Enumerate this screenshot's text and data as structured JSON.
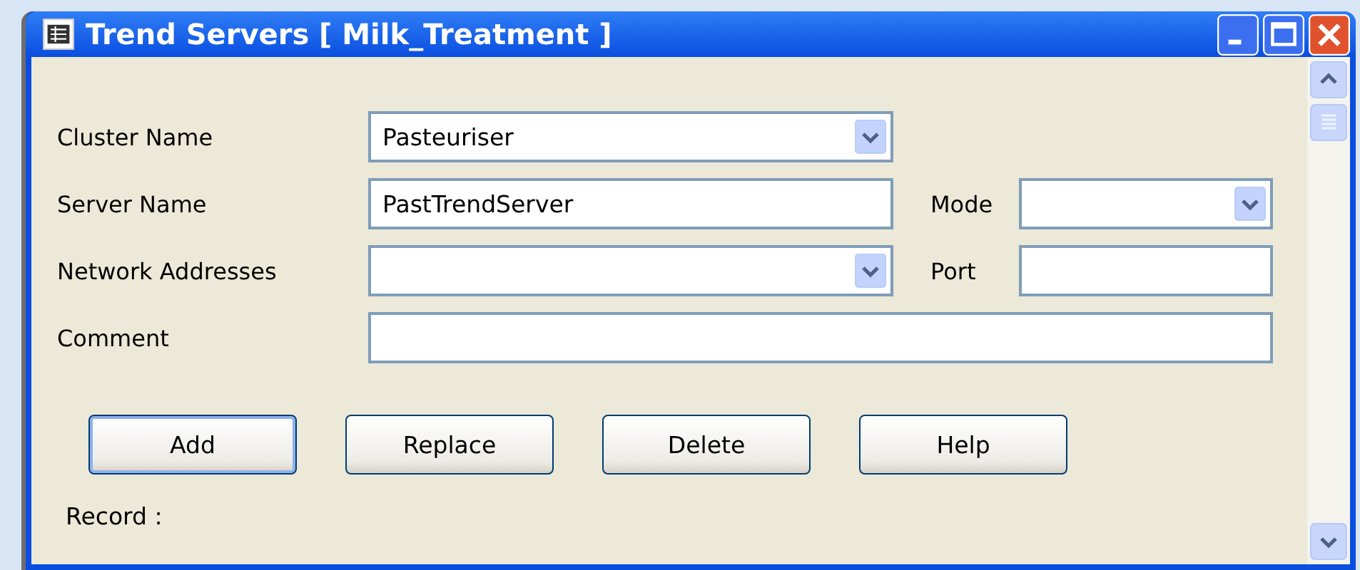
{
  "window": {
    "title": "Trend Servers [ Milk_Treatment ]"
  },
  "rows": [
    {
      "label": "Cluster Name",
      "field": {
        "kind": "combo",
        "value": "Pasteuriser"
      }
    },
    {
      "label": "Server Name",
      "field": {
        "kind": "text",
        "value": "PastTrendServer"
      },
      "side": {
        "label": "Mode",
        "field": {
          "kind": "combo"
        }
      }
    },
    {
      "label": "Network Addresses",
      "field": {
        "kind": "combo"
      },
      "side": {
        "label": "Port",
        "field": {
          "kind": "text"
        }
      }
    },
    {
      "label": "Comment",
      "field": {
        "kind": "text"
      }
    }
  ],
  "buttons": [
    {
      "label": "Add",
      "default": true
    },
    {
      "label": "Replace",
      "default": false
    },
    {
      "label": "Delete",
      "default": false
    },
    {
      "label": "Help",
      "default": false
    }
  ],
  "status": "Record :"
}
